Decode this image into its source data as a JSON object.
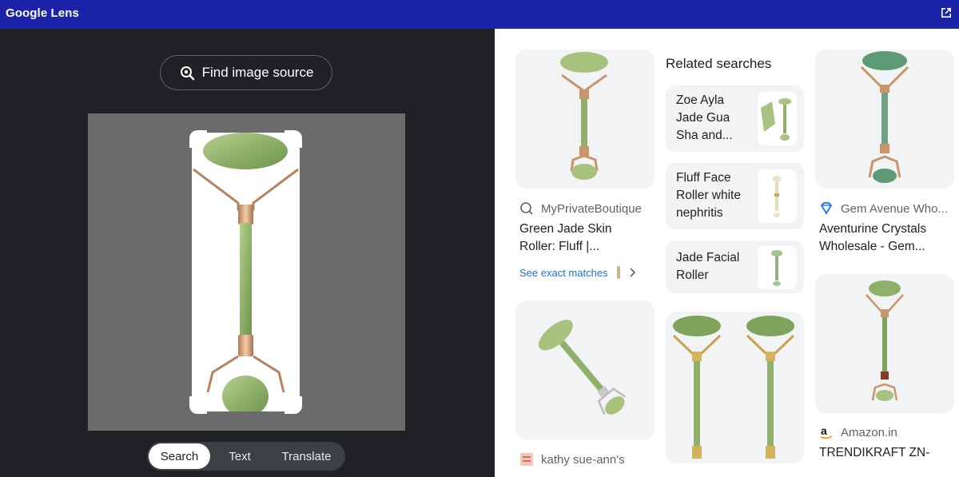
{
  "window": {
    "title": "Google Lens",
    "popout_icon": "open-in-new-icon"
  },
  "find_source": {
    "label": "Find image source",
    "icon": "lens-search-icon"
  },
  "modes": [
    {
      "label": "Search",
      "active": true
    },
    {
      "label": "Text",
      "active": false
    },
    {
      "label": "Translate",
      "active": false
    }
  ],
  "results": {
    "col1": [
      {
        "source": "MyPrivateBoutique",
        "source_icon": "globe-icon",
        "title_l1": "Green Jade Skin",
        "title_l2": "Roller: Fluff |...",
        "exact_matches": "See exact matches"
      },
      {
        "source": "kathy sue-ann's",
        "source_icon": "site-favicon"
      }
    ],
    "related": {
      "heading": "Related searches",
      "items": [
        {
          "l1": "Zoe Ayla",
          "l2": "Jade Gua",
          "l3": "Sha and..."
        },
        {
          "l1": "Fluff Face",
          "l2": "Roller white",
          "l3": "nephritis"
        },
        {
          "l1": "Jade Facial",
          "l2": "Roller",
          "l3": ""
        }
      ]
    },
    "col3": [
      {
        "source": "Gem Avenue Who...",
        "source_icon": "gem-icon",
        "title_l1": "Aventurine Crystals",
        "title_l2": "Wholesale - Gem..."
      },
      {
        "source": "Amazon.in",
        "source_icon": "amazon-icon",
        "title_l1": "TRENDIKRAFT ZN-"
      }
    ]
  },
  "colors": {
    "titlebar": "#1b23a8",
    "dark_bg": "#202124",
    "jade": "#8fb06a",
    "gold": "#c9966b",
    "link": "#1a73e8"
  }
}
